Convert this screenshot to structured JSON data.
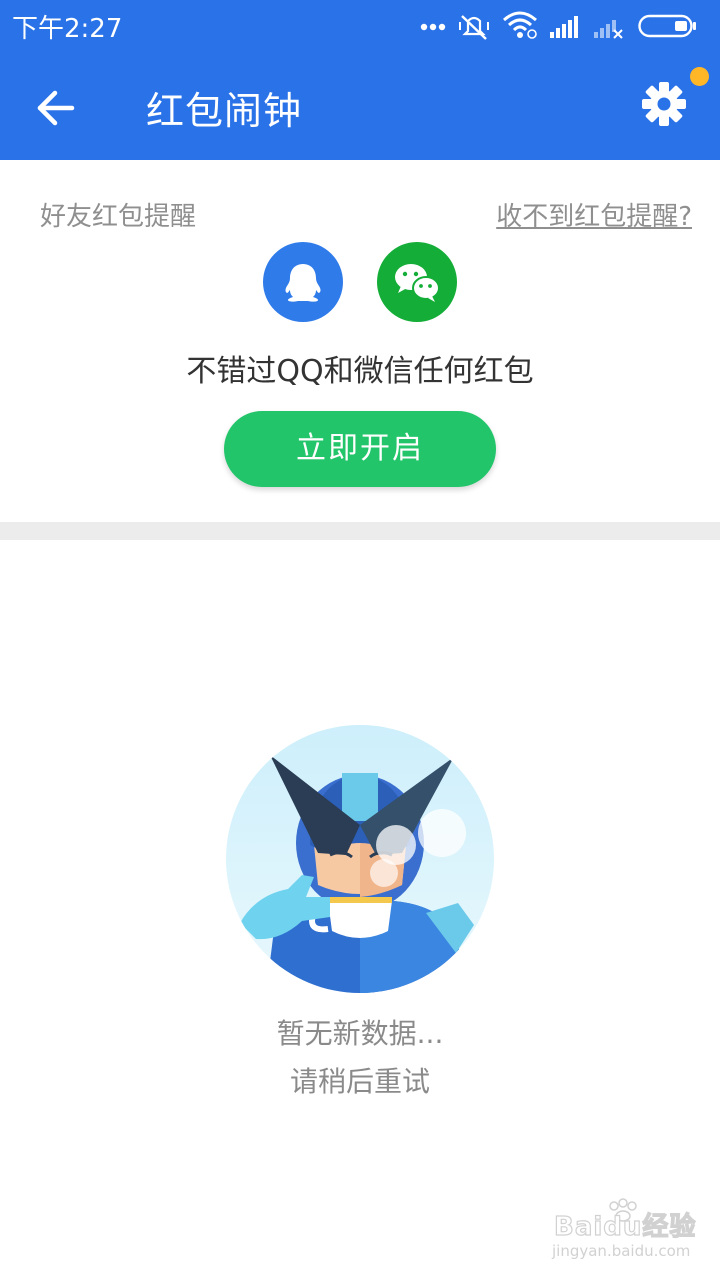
{
  "status_bar": {
    "time": "下午2:27",
    "icons": [
      "more-dots-icon",
      "vibrate-off-icon",
      "wifi-icon",
      "signal-icon",
      "signal-no-sim-icon",
      "battery-icon"
    ]
  },
  "app_bar": {
    "title": "红包闹钟",
    "back_icon": "arrow-left-icon",
    "settings_icon": "gear-icon",
    "has_notification_dot": true
  },
  "reminder_card": {
    "section_label": "好友红包提醒",
    "help_link": "收不到红包提醒?",
    "apps": [
      {
        "name": "QQ",
        "icon": "qq-icon",
        "color": "#2f7bea"
      },
      {
        "name": "WeChat",
        "icon": "wechat-icon",
        "color": "#13ad37"
      }
    ],
    "description": "不错过QQ和微信任何红包",
    "enable_button": "立即开启"
  },
  "empty_state": {
    "illustration": "superhero-drinking-coffee-illustration",
    "title": "暂无新数据...",
    "subtitle": "请稍后重试"
  },
  "watermark": {
    "brand": "Baidu经验",
    "url": "jingyan.baidu.com"
  },
  "colors": {
    "primary": "#2a72e8",
    "enable_button": "#22c56a",
    "notification_dot": "#ffb627",
    "wechat": "#13ad37",
    "qq": "#2f7bea"
  }
}
